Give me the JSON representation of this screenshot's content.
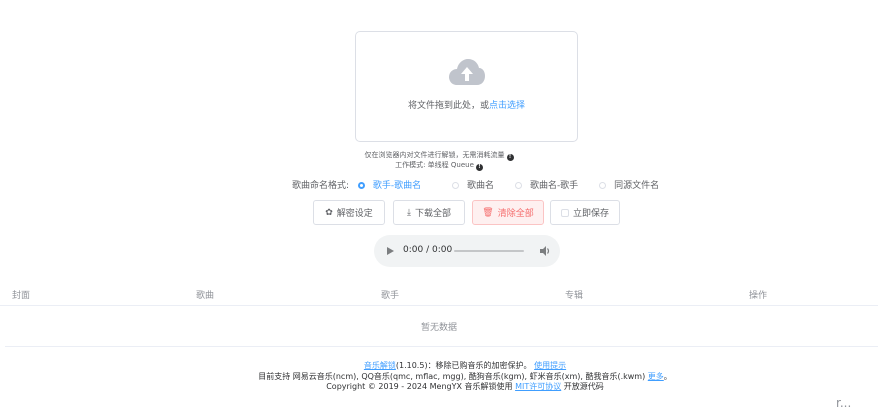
{
  "upload": {
    "text": "将文件拖到此处，或",
    "link": "点击选择",
    "icon": "cloud-upload-icon"
  },
  "tips": {
    "line1": "仅在浏览器内对文件进行解锁，无需消耗流量",
    "line2": "工作模式: 单线程 Queue"
  },
  "naming": {
    "label": "歌曲命名格式:",
    "options": [
      "歌手-歌曲名",
      "歌曲名",
      "歌曲名-歌手",
      "同源文件名"
    ],
    "selected_index": 0
  },
  "toolbar": {
    "settings": "解密设定",
    "download_all": "下载全部",
    "clear_all": "清除全部",
    "instant_save": "立即保存"
  },
  "player": {
    "time": "0:00 / 0:00"
  },
  "table": {
    "headers": [
      "封面",
      "歌曲",
      "歌手",
      "专辑",
      "操作"
    ],
    "empty_text": "暂无数据"
  },
  "footer": {
    "l1_link": "音乐解锁",
    "l1_version": "(1.10.5)：移除已购音乐的加密保护。",
    "l1_help": "使用提示",
    "l2_text": "目前支持 网易云音乐(ncm), QQ音乐(qmc, mflac, mgg), 酷狗音乐(kgm), 虾米音乐(xm), 酷我音乐(.kwm)",
    "l2_more": "更多",
    "l2_end": "。",
    "l3_text": "Copyright © 2019 - 2024 MengYX 音乐解锁使用",
    "l3_license": "MIT许可协议",
    "l3_end": "开放源代码"
  },
  "corner_text": "r..."
}
